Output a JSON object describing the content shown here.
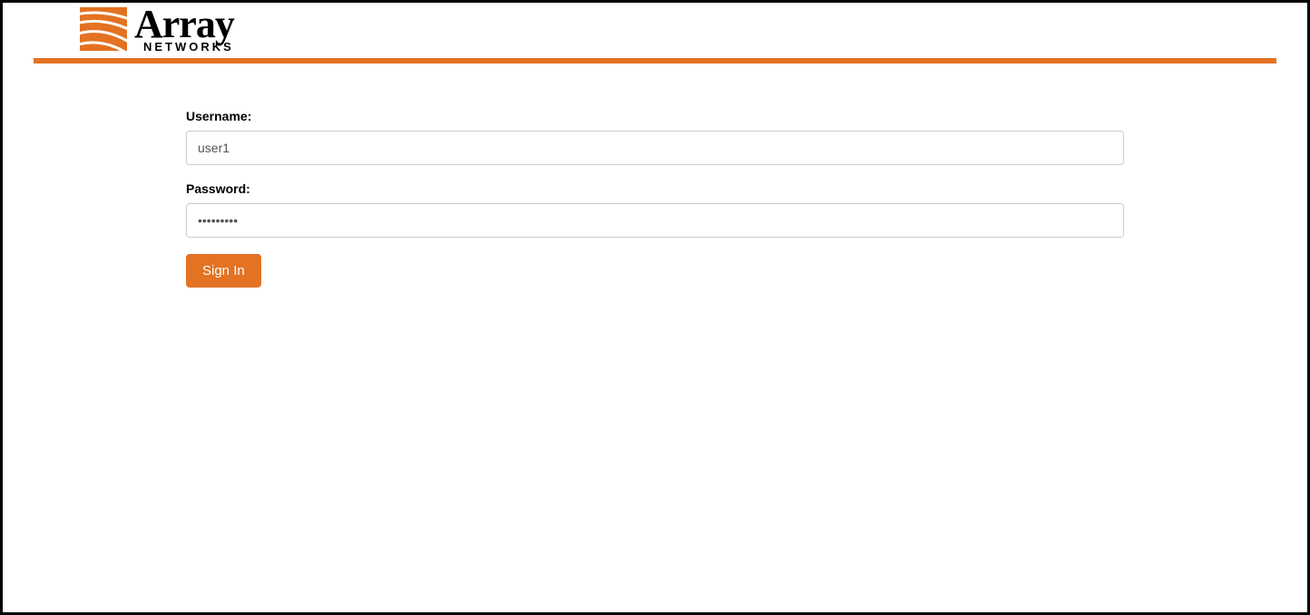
{
  "brand": {
    "main": "Array",
    "sub": "NETWORKS"
  },
  "form": {
    "username_label": "Username:",
    "username_value": "user1",
    "password_label": "Password:",
    "password_value": "•••••••••",
    "signin_label": "Sign In"
  },
  "colors": {
    "accent": "#e37222"
  }
}
